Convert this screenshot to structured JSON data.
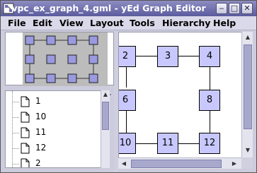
{
  "window": {
    "title": "vpc_ex_graph_4.gml - yEd Graph Editor",
    "controls": [
      "minimize",
      "maximize",
      "close"
    ],
    "minimize_glyph": "‒",
    "maximize_glyph": "□",
    "close_glyph": "✕"
  },
  "menubar": {
    "items": [
      "File",
      "Edit",
      "View",
      "Layout",
      "Tools",
      "Hierarchy",
      "Help"
    ]
  },
  "tree": {
    "items": [
      "1",
      "10",
      "11",
      "12",
      "2"
    ],
    "item_icon": "document-icon"
  },
  "graph": {
    "nodes": [
      "2",
      "3",
      "4",
      "6",
      "8",
      "10",
      "11",
      "12"
    ],
    "node_color": "#c8c8ff"
  },
  "colors": {
    "titlebar": "#6f6fb0",
    "accent": "#a8a8cc"
  }
}
